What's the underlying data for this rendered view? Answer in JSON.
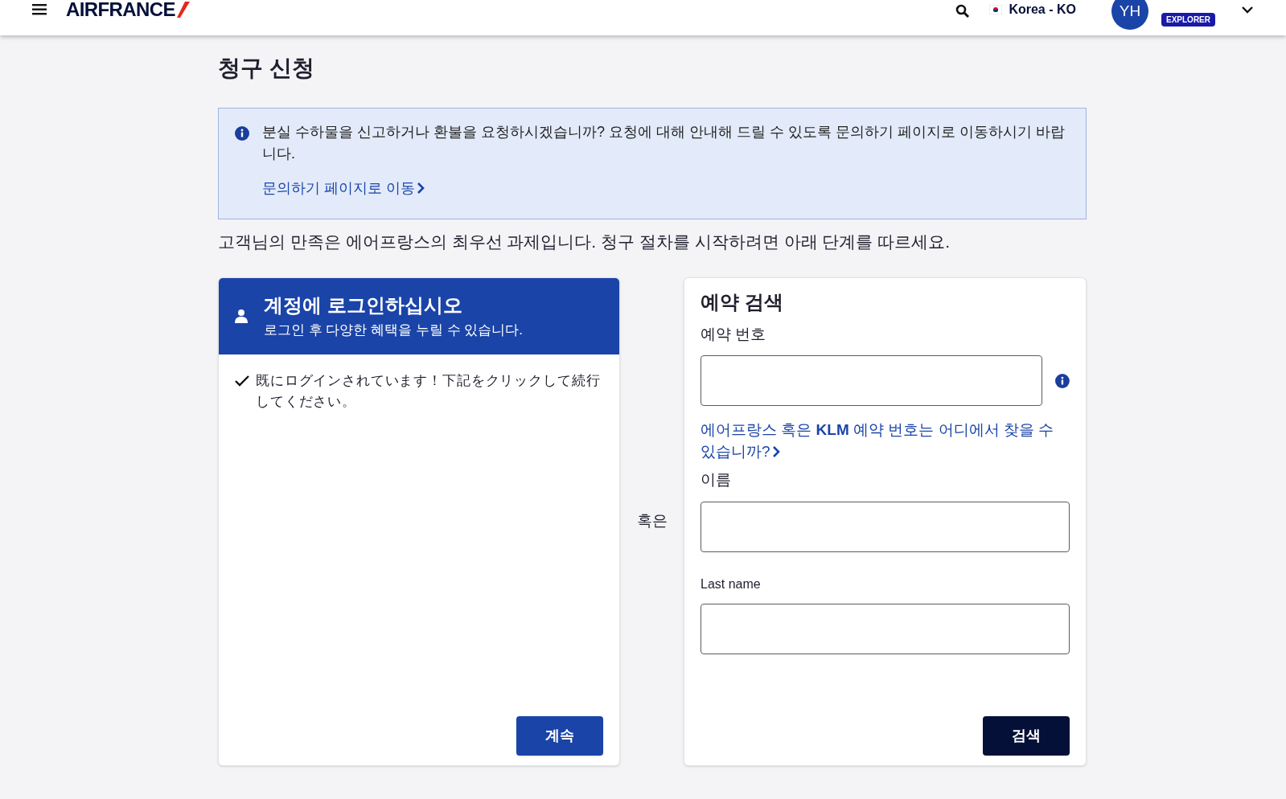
{
  "header": {
    "brand": "AIRFRANCE",
    "locale": "Korea - KO",
    "avatar": "YH",
    "tier": "EXPLORER"
  },
  "page_title": "청구 신청",
  "notice": {
    "text": "분실 수하물을 신고하거나 환불을 요청하시겠습니까? 요청에 대해 안내해 드릴 수 있도록 문의하기 페이지로 이동하시기 바랍니다.",
    "link": "문의하기 페이지로 이동"
  },
  "intro": "고객님의 만족은 에어프랑스의 최우선 과제입니다. 청구 절차를 시작하려면 아래 단계를 따르세요.",
  "login_card": {
    "title": "계정에 로그인하십시오",
    "subtitle": "로그인 후 다양한 혜택을 누릴 수 있습니다.",
    "status": "既にログインされています！下記をクリックして続行してください。",
    "logged_in": true,
    "button": "계속"
  },
  "separator": "혹은",
  "search_card": {
    "title": "예약 검색",
    "fields": [
      {
        "label": "예약 번호",
        "info": true
      },
      {
        "label": "이름",
        "info": false
      },
      {
        "label": "Last name",
        "info": false
      }
    ],
    "help_link": "에어프랑스 혹은 **KLM** 예약 번호는 어디에서 찾을 수 있습니까?",
    "button": "검색"
  }
}
